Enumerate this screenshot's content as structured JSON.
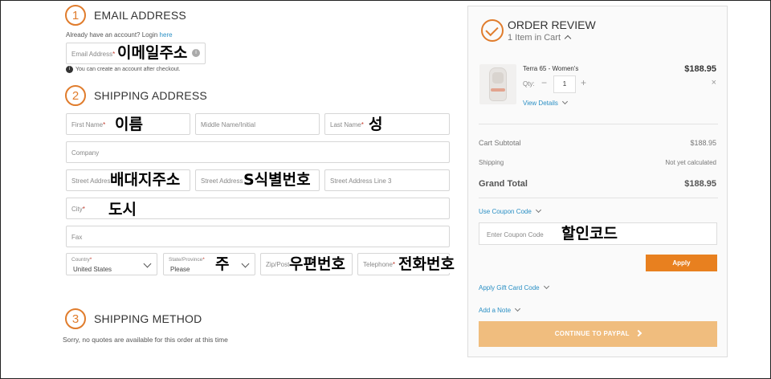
{
  "email_section": {
    "step_number": "1",
    "title": "EMAIL ADDRESS",
    "login_prompt": "Already have an account? Login",
    "login_link": "here",
    "email_placeholder": "Email Address",
    "email_overlay": "이메일주소",
    "info_note": "You can create an account after checkout."
  },
  "shipping_section": {
    "step_number": "2",
    "title": "SHIPPING ADDRESS",
    "first_name": {
      "placeholder": "First Name",
      "overlay": "이름"
    },
    "middle_name": {
      "placeholder": "Middle Name/Initial"
    },
    "last_name": {
      "placeholder": "Last Name",
      "overlay": "성"
    },
    "company": {
      "placeholder": "Company"
    },
    "street1": {
      "placeholder": "Street Address",
      "overlay": "배대지주소"
    },
    "street2": {
      "placeholder": "Street Address",
      "overlay": "S식별번호"
    },
    "street3": {
      "placeholder": "Street Address Line 3"
    },
    "city": {
      "placeholder": "City",
      "overlay": "도시"
    },
    "fax": {
      "placeholder": "Fax"
    },
    "country": {
      "label": "Country",
      "value": "United States"
    },
    "state": {
      "label": "State/Province",
      "value": "Please",
      "overlay": "주"
    },
    "zip": {
      "placeholder": "Zip/Posta",
      "overlay": "우편번호"
    },
    "telephone": {
      "placeholder": "Telephone",
      "overlay": "전화번호"
    }
  },
  "method_section": {
    "step_number": "3",
    "title": "SHIPPING METHOD",
    "note": "Sorry, no quotes are available for this order at this time"
  },
  "order_review": {
    "title": "ORDER REVIEW",
    "cart_count": "1 Item in Cart",
    "item": {
      "name": "Terra 65 - Women's",
      "price": "$188.95",
      "qty_label": "Qty:",
      "qty": "1",
      "details_link": "View Details"
    },
    "subtotal_label": "Cart Subtotal",
    "subtotal_value": "$188.95",
    "shipping_label": "Shipping",
    "shipping_value": "Not yet calculated",
    "grand_total_label": "Grand Total",
    "grand_total_value": "$188.95",
    "coupon_link": "Use Coupon Code",
    "coupon_placeholder": "Enter Coupon Code",
    "coupon_overlay": "할인코드",
    "apply_label": "Apply",
    "gift_card_link": "Apply Gift Card Code",
    "note_link": "Add a Note",
    "paypal_label": "CONTINUE TO PAYPAL"
  },
  "colors": {
    "accent": "#e07c2c",
    "link": "#2a8fc4",
    "apply_button": "#e8801f",
    "paypal_button": "#f0bd7e"
  }
}
